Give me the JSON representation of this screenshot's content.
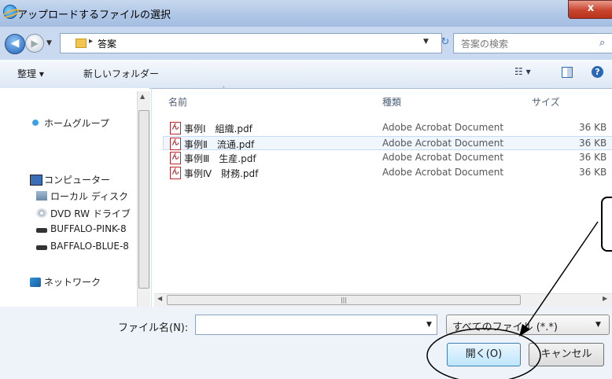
{
  "window": {
    "title": "アップロードするファイルの選択",
    "close_label": "x"
  },
  "address": {
    "path": "答案",
    "search_placeholder": "答案の検索"
  },
  "toolbar": {
    "organize": "整理 ▾",
    "new_folder": "新しいフォルダー",
    "view": "☷ ▾",
    "help": "?"
  },
  "nav": {
    "items": [
      {
        "label": "ホームグループ",
        "icon": "homegroup-icon"
      },
      {
        "label": "コンピューター",
        "icon": "computer-icon"
      },
      {
        "label": "ローカル ディスク",
        "icon": "disk-icon"
      },
      {
        "label": "DVD RW ドライブ",
        "icon": "dvd-icon"
      },
      {
        "label": "BUFFALO-PINK-8",
        "icon": "usb-drive-icon"
      },
      {
        "label": "BAFFALO-BLUE-8",
        "icon": "usb-drive-icon"
      },
      {
        "label": "ネットワーク",
        "icon": "network-icon"
      }
    ]
  },
  "columns": {
    "name": "名前",
    "type": "種類",
    "size": "サイズ"
  },
  "files": [
    {
      "name": "事例Ⅰ　組織.pdf",
      "type": "Adobe Acrobat Document",
      "size": "36 KB"
    },
    {
      "name": "事例Ⅱ　流通.pdf",
      "type": "Adobe Acrobat Document",
      "size": "36 KB"
    },
    {
      "name": "事例Ⅲ　生産.pdf",
      "type": "Adobe Acrobat Document",
      "size": "36 KB"
    },
    {
      "name": "事例Ⅳ　財務.pdf",
      "type": "Adobe Acrobat Document",
      "size": "36 KB"
    }
  ],
  "footer": {
    "filename_label": "ファイル名(N):",
    "filename_value": "",
    "filter": "すべてのファイル (*.*)",
    "open_label": "開く(O)",
    "cancel_label": "キャンセル"
  }
}
